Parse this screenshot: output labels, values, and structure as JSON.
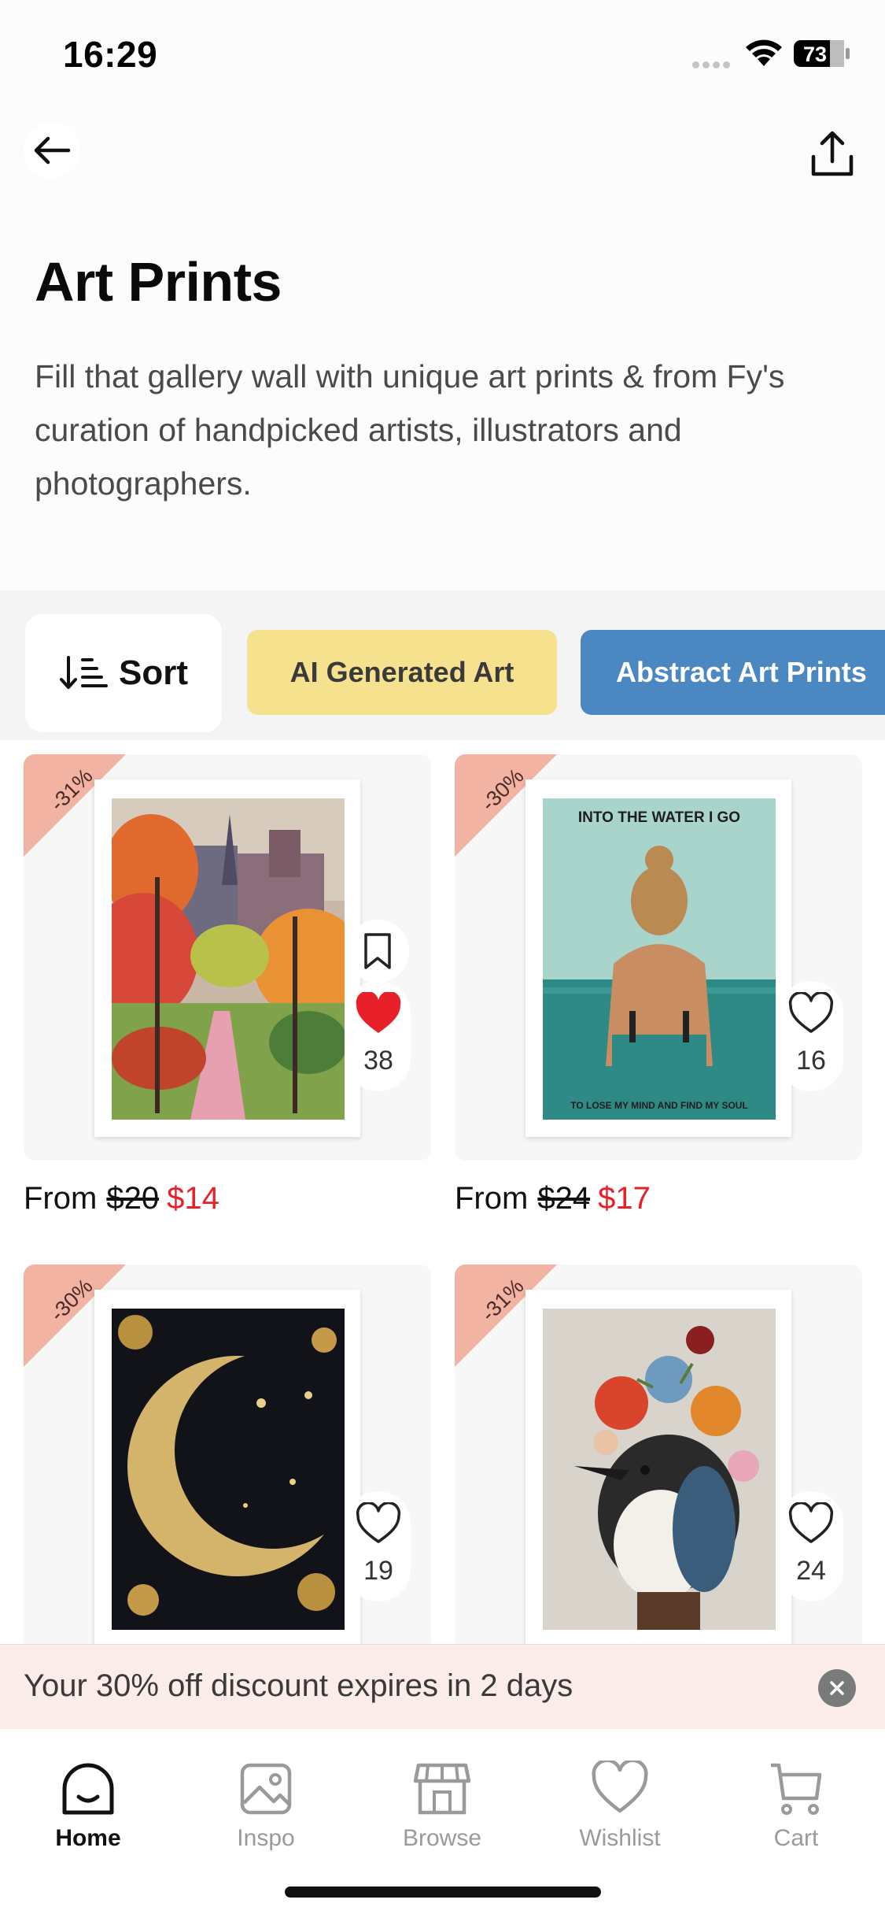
{
  "status_bar": {
    "time": "16:29",
    "battery": "73"
  },
  "header": {
    "title": "Art Prints",
    "description": "Fill that gallery wall with unique art prints & from Fy's curation of handpicked artists, illustrators and photographers."
  },
  "filters": {
    "sort_label": "Sort",
    "chips": [
      {
        "label": "AI Generated Art",
        "color": "#f6e18e"
      },
      {
        "label": "Abstract Art Prints",
        "color": "#4b88c2"
      }
    ]
  },
  "products": [
    {
      "discount": "-31%",
      "likes": "38",
      "liked": true,
      "price_prefix": "From",
      "original_price": "$20",
      "sale_price": "$14"
    },
    {
      "discount": "-30%",
      "likes": "16",
      "liked": false,
      "price_prefix": "From",
      "original_price": "$24",
      "sale_price": "$17",
      "art_text_top": "INTO THE WATER I GO",
      "art_text_bottom": "TO LOSE MY MIND AND FIND MY SOUL"
    },
    {
      "discount": "-30%",
      "likes": "19",
      "liked": false
    },
    {
      "discount": "-31%",
      "likes": "24",
      "liked": false
    }
  ],
  "banner": {
    "text": "Your 30% off discount expires in 2 days"
  },
  "tabbar": {
    "items": [
      {
        "label": "Home",
        "icon": "home-icon",
        "active": true
      },
      {
        "label": "Inspo",
        "icon": "image-icon",
        "active": false
      },
      {
        "label": "Browse",
        "icon": "shop-icon",
        "active": false
      },
      {
        "label": "Wishlist",
        "icon": "heart-icon",
        "active": false
      },
      {
        "label": "Cart",
        "icon": "cart-icon",
        "active": false
      }
    ]
  },
  "colors": {
    "sale": "#e8202a",
    "ribbon": "#f2b3a3",
    "liked_heart": "#e8202a",
    "banner_bg": "#fcedea"
  }
}
